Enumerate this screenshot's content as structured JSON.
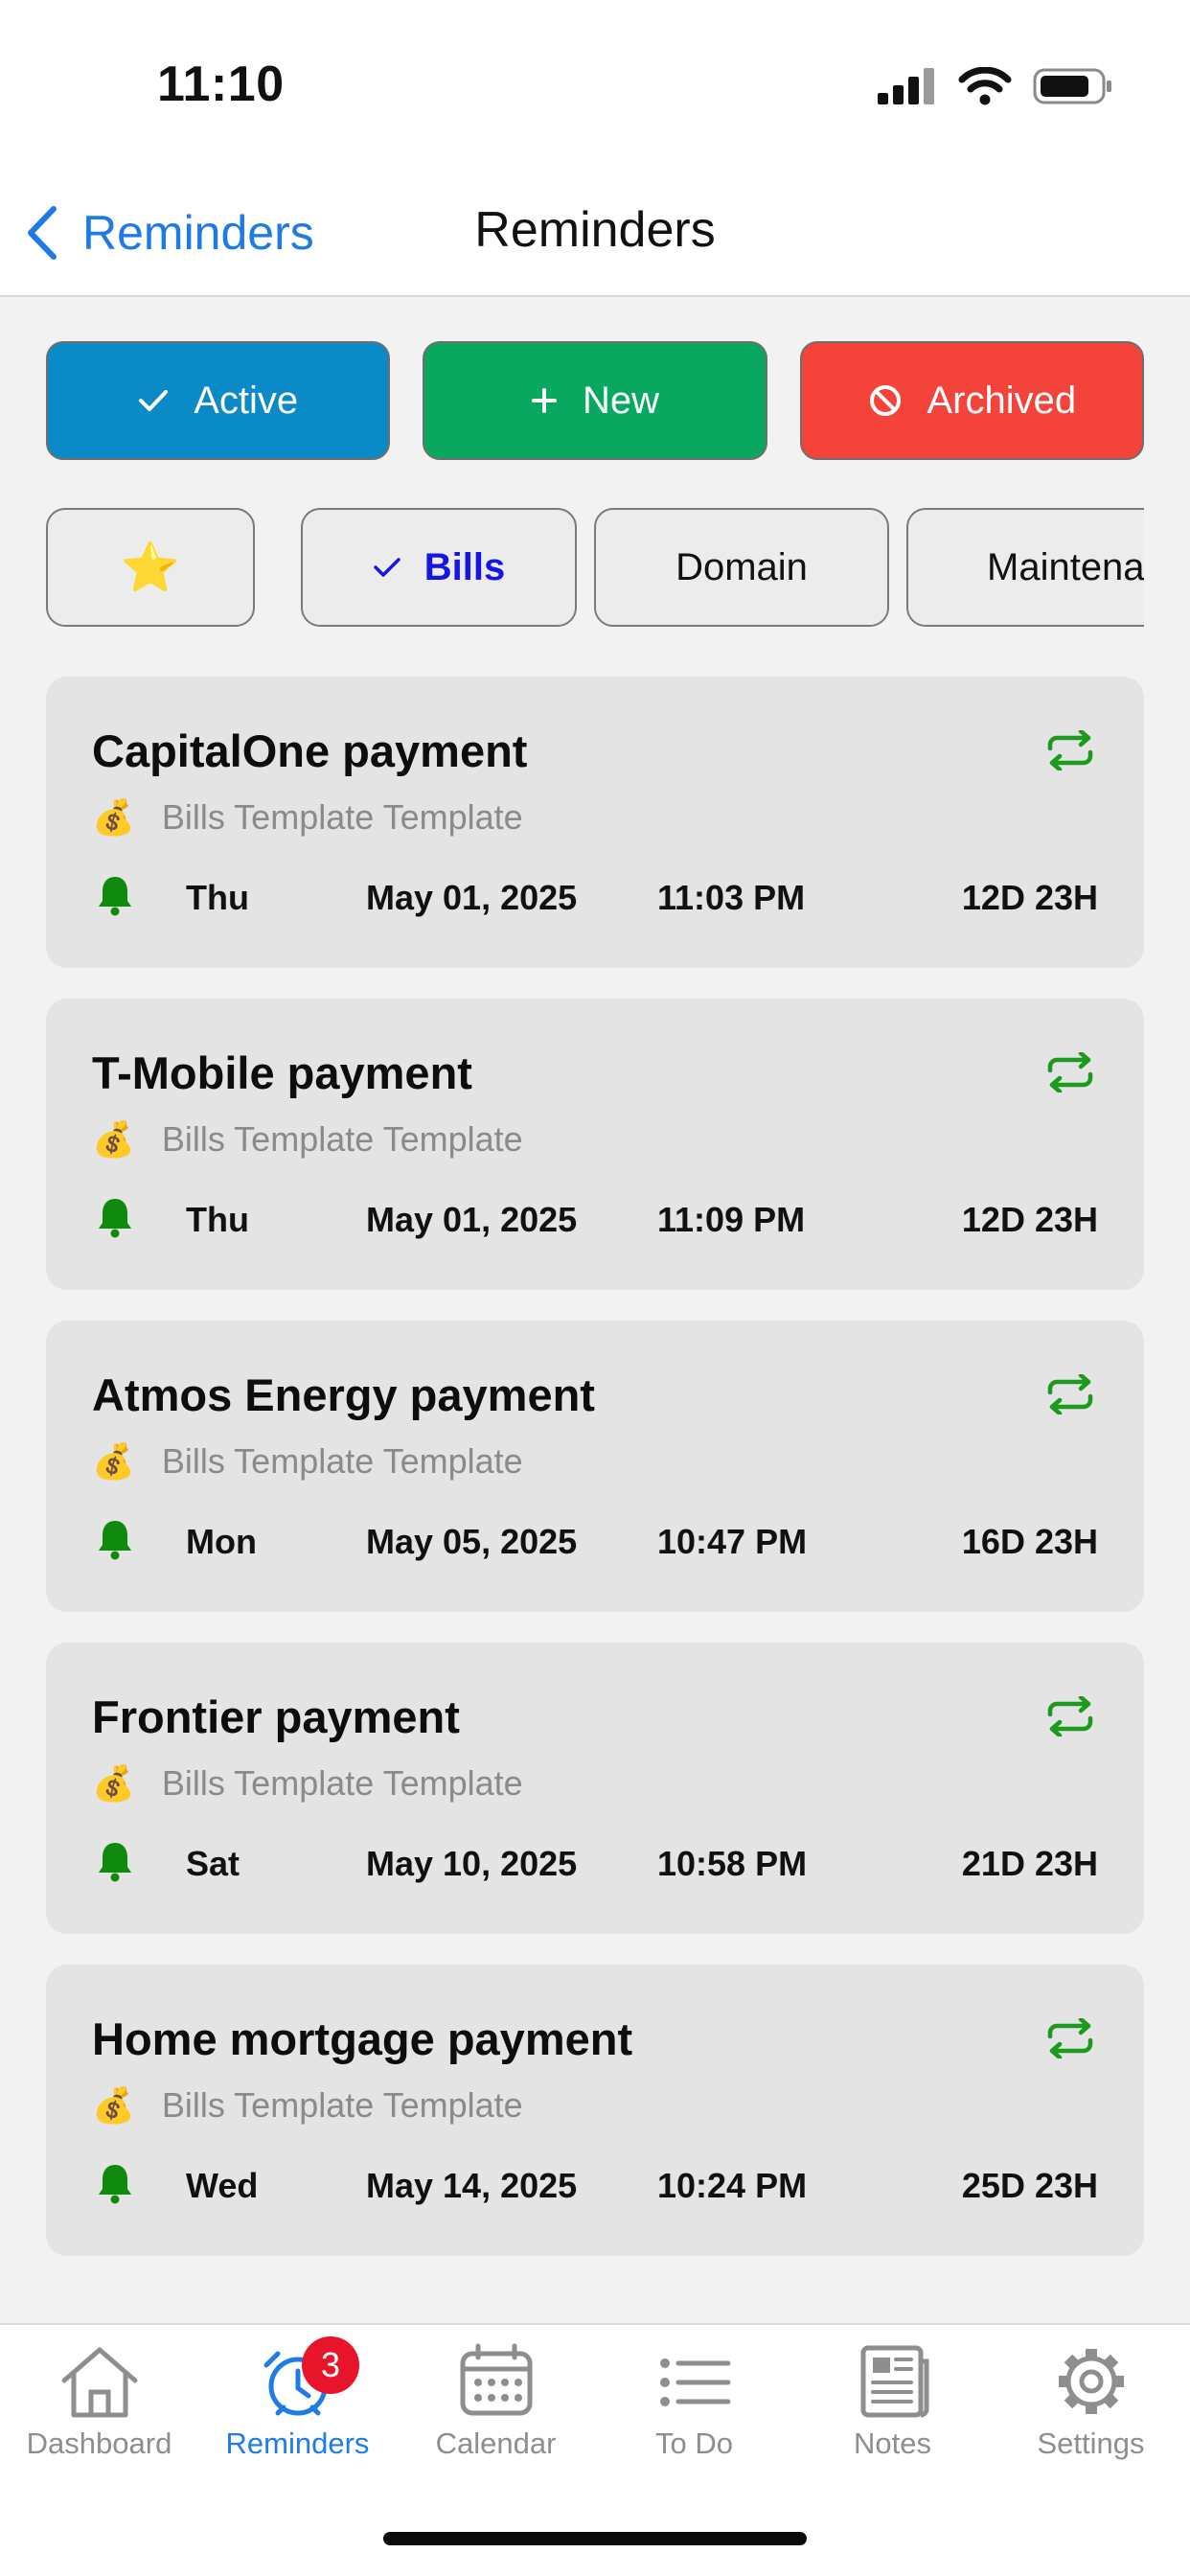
{
  "status_bar": {
    "time": "11:10"
  },
  "nav": {
    "back_label": "Reminders",
    "title": "Reminders"
  },
  "actions": [
    {
      "label": "Active",
      "color": "#0a8ac7",
      "icon": "check-icon"
    },
    {
      "label": "New",
      "color": "#08a861",
      "icon": "plus-icon"
    },
    {
      "label": "Archived",
      "color": "#f4433a",
      "icon": "prohibited-icon"
    }
  ],
  "chips": {
    "star_glyph": "⭐",
    "bills": "Bills",
    "domain": "Domain",
    "maintenance": "Maintenance"
  },
  "template_glyph": "💰",
  "reminders": [
    {
      "title": "CapitalOne payment",
      "template": "Bills Template Template",
      "day": "Thu",
      "date": "May 01, 2025",
      "time": "11:03 PM",
      "remaining": "12D 23H"
    },
    {
      "title": "T-Mobile payment",
      "template": "Bills Template Template",
      "day": "Thu",
      "date": "May 01, 2025",
      "time": "11:09 PM",
      "remaining": "12D 23H"
    },
    {
      "title": "Atmos Energy payment",
      "template": "Bills Template Template",
      "day": "Mon",
      "date": "May 05, 2025",
      "time": "10:47 PM",
      "remaining": "16D 23H"
    },
    {
      "title": "Frontier payment",
      "template": "Bills Template Template",
      "day": "Sat",
      "date": "May 10, 2025",
      "time": "10:58 PM",
      "remaining": "21D 23H"
    },
    {
      "title": "Home mortgage payment",
      "template": "Bills Template Template",
      "day": "Wed",
      "date": "May 14, 2025",
      "time": "10:24 PM",
      "remaining": "25D 23H"
    }
  ],
  "tabs": [
    {
      "label": "Dashboard",
      "icon": "home-icon"
    },
    {
      "label": "Reminders",
      "icon": "alarm-clock-icon",
      "badge": "3"
    },
    {
      "label": "Calendar",
      "icon": "calendar-icon"
    },
    {
      "label": "To Do",
      "icon": "list-icon"
    },
    {
      "label": "Notes",
      "icon": "newspaper-icon"
    },
    {
      "label": "Settings",
      "icon": "gear-icon"
    }
  ],
  "colors": {
    "accent": "#1f7be8",
    "bell": "#0f8a0f",
    "repeat": "#1d9a1d",
    "bills_chip_text": "#1515e6",
    "badge": "#e8152a"
  }
}
